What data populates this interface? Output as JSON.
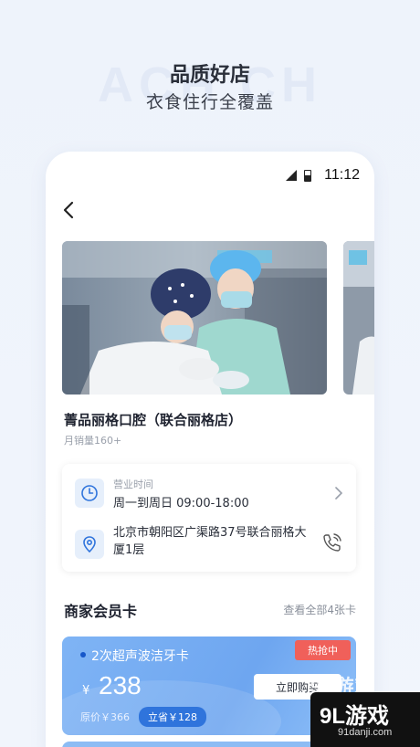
{
  "background_watermark": "ACH    CH",
  "hero": {
    "title": "品质好店",
    "subtitle": "衣食住行全覆盖"
  },
  "status_bar": {
    "time": "11:12"
  },
  "store": {
    "name": "菁品丽格口腔（联合丽格店）",
    "sales": "月销量160+"
  },
  "info": {
    "hours_label": "营业时间",
    "hours_value": "周一到周日  09:00-18:00",
    "address": "北京市朝阳区广渠路37号联合丽格大厦1层"
  },
  "member_section": {
    "title": "商家会员卡",
    "view_all": "查看全部4张卡"
  },
  "member_card": {
    "name": "2次超声波洁牙卡",
    "hot_badge": "热抢中",
    "currency": "¥",
    "price": "238",
    "buy_label": "立即购买",
    "original_price": "原价￥366",
    "save_label": "立省￥128"
  },
  "watermark": {
    "top_text": "9L游戏",
    "brand": "9L游戏",
    "url": "91danji.com"
  },
  "colors": {
    "accent": "#2f74dc",
    "card_blue": "#6ea6f0",
    "hot_red": "#f0605a",
    "icon_bg": "#e6effb"
  }
}
